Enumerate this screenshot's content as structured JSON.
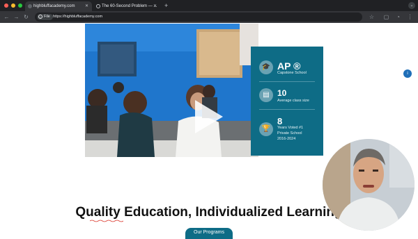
{
  "browser": {
    "tabs": [
      {
        "label": "highbluffacademy.com",
        "active": true
      },
      {
        "label": "The 60-Second Problem — ...",
        "active": false
      }
    ],
    "new_tab_symbol": "+",
    "address": {
      "chip": "File",
      "url": "https://highbluffacademy.com"
    },
    "colors": {
      "frame": "#202124",
      "toolbar": "#35363a"
    }
  },
  "hero": {
    "play_icon": "play-icon",
    "image": "students-in-classroom"
  },
  "stats": [
    {
      "icon": "graduation-icon",
      "value": "AP ®",
      "label": "Capstone School"
    },
    {
      "icon": "classroom-icon",
      "value": "10",
      "label": "Average class size"
    },
    {
      "icon": "trophy-icon",
      "value": "8",
      "label_lines": [
        "Years Voted #1",
        "Private School",
        "2016-2024"
      ]
    }
  ],
  "heading": "Quality Education, Individualized Learning",
  "cta_label": "Our Programs",
  "side_badge": "i",
  "colors": {
    "accent": "#0e6c86",
    "hero_wall": "#1e74c8"
  }
}
